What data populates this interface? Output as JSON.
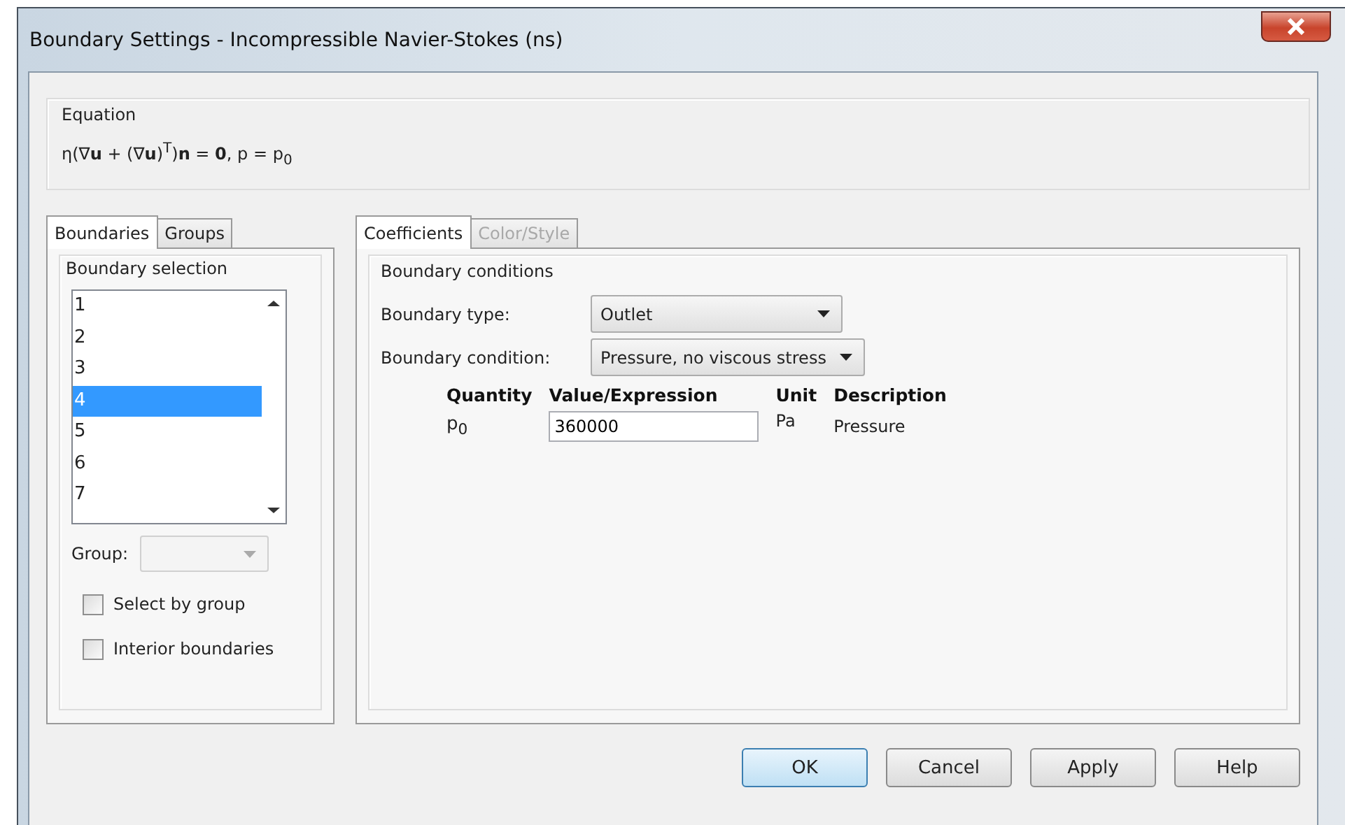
{
  "window": {
    "title": "Boundary Settings - Incompressible Navier-Stokes (ns)"
  },
  "equation": {
    "label": "Equation",
    "formula": "η(∇**u** + (∇**u**)$^{T}$)**n** = **0**, p = p$_{0}$"
  },
  "left_tabs": [
    {
      "label": "Boundaries",
      "selected": true
    },
    {
      "label": "Groups",
      "selected": false
    }
  ],
  "boundary_selection": {
    "label": "Boundary selection",
    "items": [
      {
        "label": "1",
        "selected": false
      },
      {
        "label": "2",
        "selected": false
      },
      {
        "label": "3",
        "selected": false
      },
      {
        "label": "4",
        "selected": true
      },
      {
        "label": "5",
        "selected": false
      },
      {
        "label": "6",
        "selected": false
      },
      {
        "label": "7",
        "selected": false
      }
    ]
  },
  "group": {
    "label": "Group:",
    "disabled": true
  },
  "checkboxes": [
    {
      "label": "Select by group",
      "checked": false
    },
    {
      "label": "Interior boundaries",
      "checked": false
    }
  ],
  "right_tabs": [
    {
      "label": "Coefficients",
      "selected": true,
      "disabled": false
    },
    {
      "label": "Color/Style",
      "selected": false,
      "disabled": true
    }
  ],
  "boundary_conditions": {
    "label": "Boundary conditions",
    "fields": [
      {
        "label": "Boundary type:",
        "value": "Outlet"
      },
      {
        "label": "Boundary condition:",
        "value": "Pressure, no viscous stress"
      }
    ],
    "columns": [
      "Quantity",
      "Value/Expression",
      "Unit",
      "Description"
    ],
    "rows": [
      {
        "quantity": "p$_{0}$",
        "value": "360000",
        "unit": "Pa",
        "description": "Pressure"
      }
    ]
  },
  "buttons": [
    {
      "label": "OK",
      "default": true
    },
    {
      "label": "Cancel",
      "default": false
    },
    {
      "label": "Apply",
      "default": false
    },
    {
      "label": "Help",
      "default": false
    }
  ]
}
